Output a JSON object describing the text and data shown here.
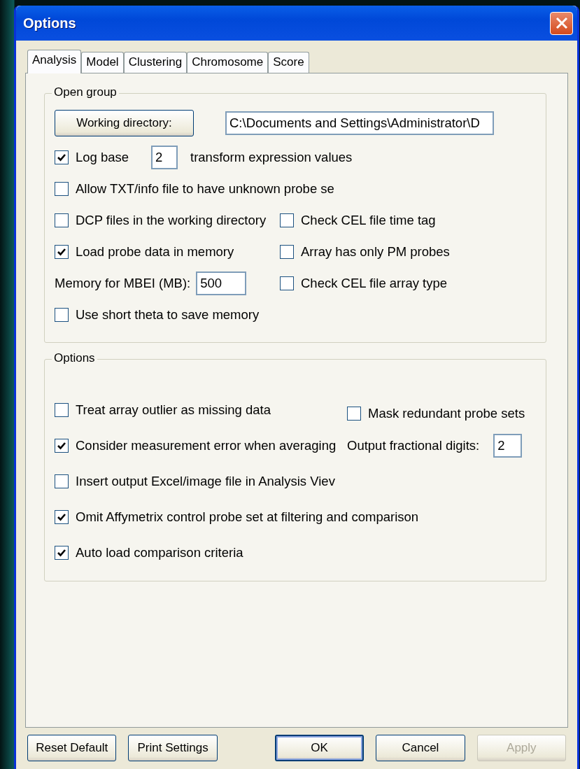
{
  "window": {
    "title": "Options"
  },
  "tabs": [
    {
      "label": "Analysis",
      "selected": true
    },
    {
      "label": "Model",
      "selected": false
    },
    {
      "label": "Clustering",
      "selected": false
    },
    {
      "label": "Chromosome",
      "selected": false
    },
    {
      "label": "Score",
      "selected": false
    }
  ],
  "groups": [
    {
      "legend": "Open group",
      "rows": [
        {
          "cells": [
            {
              "kind": "button_field",
              "label": "Working directory:",
              "value": "C:\\Documents and Settings\\Administrator\\D"
            }
          ]
        },
        {
          "cells": [
            {
              "kind": "checkbox_field",
              "label": "Log base",
              "checked": true,
              "value": "2",
              "suffix": "transform expression values"
            }
          ]
        },
        {
          "cells": [
            {
              "kind": "checkbox",
              "label": "Allow TXT/info file to have unknown probe se",
              "checked": false
            }
          ]
        },
        {
          "cells": [
            {
              "kind": "checkbox",
              "label": "DCP files in the working directory",
              "checked": false
            },
            {
              "kind": "checkbox",
              "label": "Check CEL file time tag",
              "checked": false
            }
          ]
        },
        {
          "cells": [
            {
              "kind": "checkbox",
              "label": "Load probe data in memory",
              "checked": true
            },
            {
              "kind": "checkbox",
              "label": "Array has only PM probes",
              "checked": false
            }
          ]
        },
        {
          "cells": [
            {
              "kind": "labeled_field",
              "label": "Memory for MBEI (MB):",
              "value": "500"
            },
            {
              "kind": "checkbox",
              "label": "Check CEL file array type",
              "checked": false
            }
          ]
        },
        {
          "cells": [
            {
              "kind": "checkbox",
              "label": "Use short theta to save memory",
              "checked": false
            }
          ]
        }
      ]
    },
    {
      "legend": "Options",
      "rows": [
        {
          "cells": [
            {
              "kind": "checkbox",
              "label": "Treat array outlier as missing data",
              "checked": false
            },
            {
              "kind": "checkbox",
              "label": "Mask redundant probe sets",
              "checked": false
            }
          ]
        },
        {
          "cells": [
            {
              "kind": "checkbox",
              "label": "Consider measurement error when averaging",
              "checked": true
            },
            {
              "kind": "labeled_field",
              "label": "Output fractional digits:",
              "value": "2"
            }
          ]
        },
        {
          "cells": [
            {
              "kind": "checkbox",
              "label": "Insert output Excel/image file in Analysis Viev",
              "checked": false
            }
          ]
        },
        {
          "cells": [
            {
              "kind": "checkbox",
              "label": "Omit Affymetrix control probe set at filtering and comparison",
              "checked": true
            }
          ]
        },
        {
          "cells": [
            {
              "kind": "checkbox",
              "label": "Auto load comparison criteria",
              "checked": true
            }
          ]
        }
      ]
    }
  ],
  "buttons": [
    {
      "label": "Reset Default",
      "default": false,
      "disabled": false
    },
    {
      "label": "Print Settings",
      "default": false,
      "disabled": false
    },
    {
      "label": "OK",
      "default": true,
      "disabled": false
    },
    {
      "label": "Cancel",
      "default": false,
      "disabled": false
    },
    {
      "label": "Apply",
      "default": false,
      "disabled": true
    }
  ]
}
